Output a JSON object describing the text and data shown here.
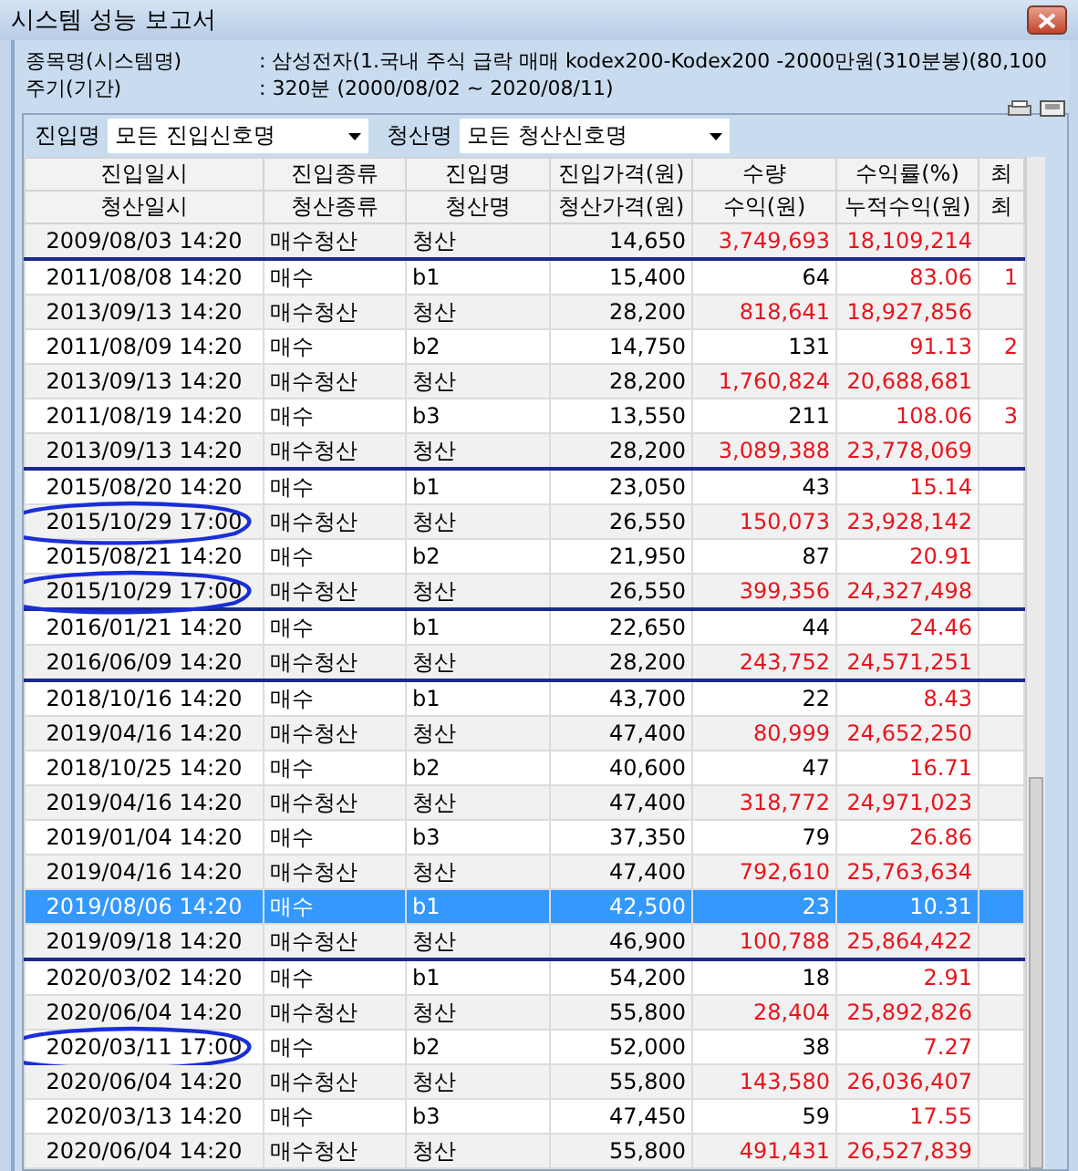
{
  "window": {
    "title": "시스템 성능 보고서"
  },
  "info": [
    {
      "label": "종목명(시스템명)",
      "value": ": 삼성전자(1.국내 주식 급락 매매 kodex200-Kodex200 -2000만원(310분봉)(80,100"
    },
    {
      "label": "주기(기간)",
      "value": ": 320분 (2000/08/02 ~ 2020/08/11)"
    }
  ],
  "filters": [
    {
      "label": "진입명",
      "value": "모든 진입신호명"
    },
    {
      "label": "청산명",
      "value": "모든 청산신호명"
    }
  ],
  "table": {
    "header_rows": [
      [
        "진입일시",
        "진입종류",
        "진입명",
        "진입가격(원)",
        "수량",
        "수익률(%)",
        "최"
      ],
      [
        "청산일시",
        "청산종류",
        "청산명",
        "청산가격(원)",
        "수익(원)",
        "누적수익(원)",
        "최"
      ]
    ],
    "rows": [
      {
        "kind": "exit",
        "cells": [
          "2009/08/03 14:20",
          "매수청산",
          "청산",
          "14,650",
          "3,749,693",
          "18,109,214"
        ],
        "selected": false,
        "circled": false,
        "group_end": true
      },
      {
        "kind": "entry",
        "cells": [
          "2011/08/08 14:20",
          "매수",
          "b1",
          "15,400",
          "64",
          "83.06"
        ],
        "column_7": "1",
        "selected": false,
        "circled": false,
        "group_end": false
      },
      {
        "kind": "exit",
        "cells": [
          "2013/09/13 14:20",
          "매수청산",
          "청산",
          "28,200",
          "818,641",
          "18,927,856"
        ],
        "selected": false,
        "circled": false,
        "group_end": false
      },
      {
        "kind": "entry",
        "cells": [
          "2011/08/09 14:20",
          "매수",
          "b2",
          "14,750",
          "131",
          "91.13"
        ],
        "column_7": "2",
        "selected": false,
        "circled": false,
        "group_end": false
      },
      {
        "kind": "exit",
        "cells": [
          "2013/09/13 14:20",
          "매수청산",
          "청산",
          "28,200",
          "1,760,824",
          "20,688,681"
        ],
        "selected": false,
        "circled": false,
        "group_end": false
      },
      {
        "kind": "entry",
        "cells": [
          "2011/08/19 14:20",
          "매수",
          "b3",
          "13,550",
          "211",
          "108.06"
        ],
        "column_7": "3",
        "selected": false,
        "circled": false,
        "group_end": false
      },
      {
        "kind": "exit",
        "cells": [
          "2013/09/13 14:20",
          "매수청산",
          "청산",
          "28,200",
          "3,089,388",
          "23,778,069"
        ],
        "selected": false,
        "circled": false,
        "group_end": true
      },
      {
        "kind": "entry",
        "cells": [
          "2015/08/20 14:20",
          "매수",
          "b1",
          "23,050",
          "43",
          "15.14"
        ],
        "selected": false,
        "circled": false,
        "group_end": false
      },
      {
        "kind": "exit",
        "cells": [
          "2015/10/29 17:00",
          "매수청산",
          "청산",
          "26,550",
          "150,073",
          "23,928,142"
        ],
        "selected": false,
        "circled": true,
        "group_end": false
      },
      {
        "kind": "entry",
        "cells": [
          "2015/08/21 14:20",
          "매수",
          "b2",
          "21,950",
          "87",
          "20.91"
        ],
        "selected": false,
        "circled": false,
        "group_end": false
      },
      {
        "kind": "exit",
        "cells": [
          "2015/10/29 17:00",
          "매수청산",
          "청산",
          "26,550",
          "399,356",
          "24,327,498"
        ],
        "selected": false,
        "circled": true,
        "group_end": true
      },
      {
        "kind": "entry",
        "cells": [
          "2016/01/21 14:20",
          "매수",
          "b1",
          "22,650",
          "44",
          "24.46"
        ],
        "selected": false,
        "circled": false,
        "group_end": false
      },
      {
        "kind": "exit",
        "cells": [
          "2016/06/09 14:20",
          "매수청산",
          "청산",
          "28,200",
          "243,752",
          "24,571,251"
        ],
        "selected": false,
        "circled": false,
        "group_end": true
      },
      {
        "kind": "entry",
        "cells": [
          "2018/10/16 14:20",
          "매수",
          "b1",
          "43,700",
          "22",
          "8.43"
        ],
        "selected": false,
        "circled": false,
        "group_end": false
      },
      {
        "kind": "exit",
        "cells": [
          "2019/04/16 14:20",
          "매수청산",
          "청산",
          "47,400",
          "80,999",
          "24,652,250"
        ],
        "selected": false,
        "circled": false,
        "group_end": false
      },
      {
        "kind": "entry",
        "cells": [
          "2018/10/25 14:20",
          "매수",
          "b2",
          "40,600",
          "47",
          "16.71"
        ],
        "selected": false,
        "circled": false,
        "group_end": false
      },
      {
        "kind": "exit",
        "cells": [
          "2019/04/16 14:20",
          "매수청산",
          "청산",
          "47,400",
          "318,772",
          "24,971,023"
        ],
        "selected": false,
        "circled": false,
        "group_end": false
      },
      {
        "kind": "entry",
        "cells": [
          "2019/01/04 14:20",
          "매수",
          "b3",
          "37,350",
          "79",
          "26.86"
        ],
        "selected": false,
        "circled": false,
        "group_end": false
      },
      {
        "kind": "exit",
        "cells": [
          "2019/04/16 14:20",
          "매수청산",
          "청산",
          "47,400",
          "792,610",
          "25,763,634"
        ],
        "selected": false,
        "circled": false,
        "group_end": false
      },
      {
        "kind": "entry",
        "cells": [
          "2019/08/06 14:20",
          "매수",
          "b1",
          "42,500",
          "23",
          "10.31"
        ],
        "selected": true,
        "circled": false,
        "group_end": false
      },
      {
        "kind": "exit",
        "cells": [
          "2019/09/18 14:20",
          "매수청산",
          "청산",
          "46,900",
          "100,788",
          "25,864,422"
        ],
        "selected": false,
        "circled": false,
        "group_end": true
      },
      {
        "kind": "entry",
        "cells": [
          "2020/03/02 14:20",
          "매수",
          "b1",
          "54,200",
          "18",
          "2.91"
        ],
        "selected": false,
        "circled": false,
        "group_end": false
      },
      {
        "kind": "exit",
        "cells": [
          "2020/06/04 14:20",
          "매수청산",
          "청산",
          "55,800",
          "28,404",
          "25,892,826"
        ],
        "selected": false,
        "circled": false,
        "group_end": false
      },
      {
        "kind": "entry",
        "cells": [
          "2020/03/11 17:00",
          "매수",
          "b2",
          "52,000",
          "38",
          "7.27"
        ],
        "selected": false,
        "circled": true,
        "group_end": false
      },
      {
        "kind": "exit",
        "cells": [
          "2020/06/04 14:20",
          "매수청산",
          "청산",
          "55,800",
          "143,580",
          "26,036,407"
        ],
        "selected": false,
        "circled": false,
        "group_end": false
      },
      {
        "kind": "entry",
        "cells": [
          "2020/03/13 14:20",
          "매수",
          "b3",
          "47,450",
          "59",
          "17.55"
        ],
        "selected": false,
        "circled": false,
        "group_end": false
      },
      {
        "kind": "exit",
        "cells": [
          "2020/06/04 14:20",
          "매수청산",
          "청산",
          "55,800",
          "491,431",
          "26,527,839"
        ],
        "selected": false,
        "circled": false,
        "group_end": false
      }
    ]
  }
}
